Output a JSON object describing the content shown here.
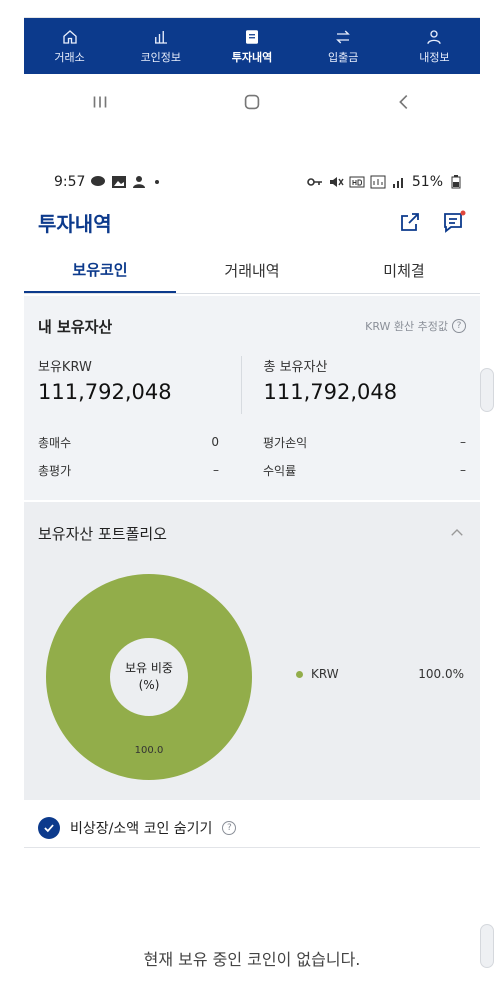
{
  "bottom_tabbar": {
    "items": [
      {
        "label": "거래소",
        "icon": "home-icon"
      },
      {
        "label": "코인정보",
        "icon": "bar-chart-icon"
      },
      {
        "label": "투자내역",
        "icon": "document-icon",
        "active": true
      },
      {
        "label": "입출금",
        "icon": "transfer-icon"
      },
      {
        "label": "내정보",
        "icon": "user-icon"
      }
    ]
  },
  "status_bar": {
    "time": "9:57",
    "battery": "51%"
  },
  "header": {
    "title": "투자내역"
  },
  "tabs": [
    "보유코인",
    "거래내역",
    "미체결"
  ],
  "assets": {
    "title": "내 보유자산",
    "krw_note": "KRW 환산 추정값",
    "krw_label": "보유KRW",
    "krw_value": "111,792,048",
    "total_label": "총 보유자산",
    "total_value": "111,792,048",
    "left_rows": [
      {
        "label": "총매수",
        "value": "0"
      },
      {
        "label": "총평가",
        "value": "–"
      }
    ],
    "right_rows": [
      {
        "label": "평가손익",
        "value": "–"
      },
      {
        "label": "수익률",
        "value": "–"
      }
    ]
  },
  "portfolio": {
    "title": "보유자산 포트폴리오",
    "center_line1": "보유 비중",
    "center_line2": "(%)",
    "slice_label": "100.0",
    "legend": [
      {
        "name": "KRW",
        "percent": "100.0%"
      }
    ],
    "slice_share": 1.0,
    "color": "#92ad4a"
  },
  "hide_option": {
    "label": "비상장/소액 코인 숨기기",
    "checked": true
  },
  "empty_message": "현재 보유 중인 코인이 없습니다.",
  "colors": {
    "brand": "#0c3a8c",
    "panel": "#f1f3f6",
    "chart_green": "#92ad4a"
  }
}
